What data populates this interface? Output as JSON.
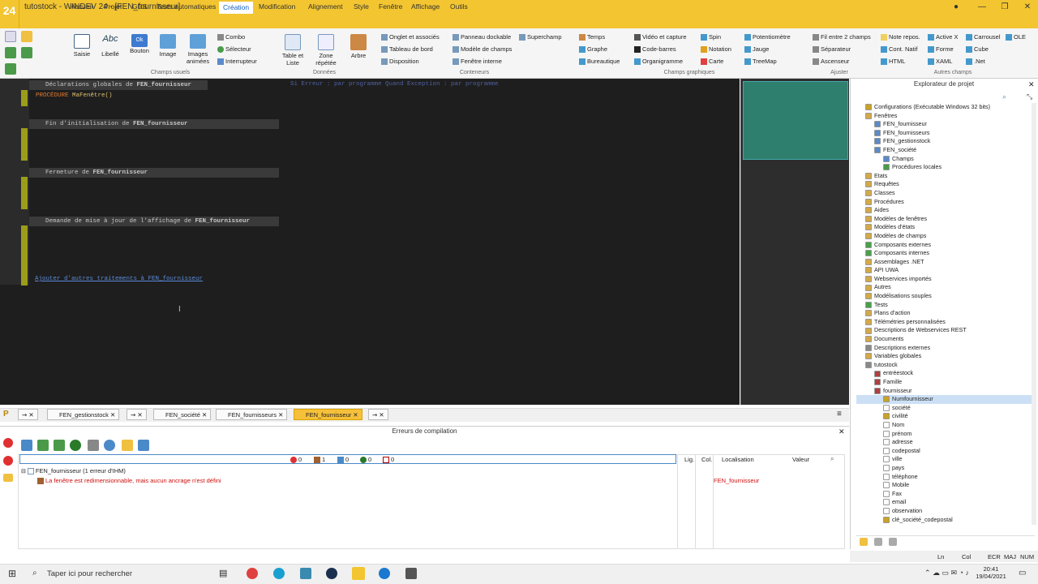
{
  "window": {
    "title": "tutostock - WINDEV 24 - [FEN_fournisseur]",
    "logo": "24"
  },
  "menu": [
    "Accueil",
    "Projet",
    "GDS",
    "Tests automatiques",
    "Création",
    "Modification",
    "Alignement",
    "Style",
    "Fenêtre",
    "Affichage",
    "Outils"
  ],
  "ribbon": {
    "big": [
      "Saisie",
      "Libellé",
      "Bouton",
      "Image",
      "Images animées"
    ],
    "champs_small": [
      "Combo",
      "Sélecteur",
      "Interrupteur"
    ],
    "donnees": [
      "Table et Liste",
      "Zone répétée",
      "Arbre"
    ],
    "conteneurs": [
      "Onglet et associés",
      "Tableau de bord",
      "Disposition",
      "Panneau dockable",
      "Modèle de champs",
      "Fenêtre interne",
      "Superchamp"
    ],
    "graph": [
      "Temps",
      "Graphe",
      "Bureautique",
      "Vidéo et capture",
      "Code-barres",
      "Organigramme",
      "Spin",
      "Notation",
      "Carte",
      "Potentiomètre",
      "Jauge",
      "TreeMap"
    ],
    "ajuster": [
      "Fil entre 2 champs",
      "Séparateur",
      "Ascenseur"
    ],
    "autres": [
      "Note repos.",
      "Active X",
      "Carrousel",
      "OLE",
      "Cont. Natif",
      "Forme",
      "Cube",
      "HTML",
      "XAML",
      ".Net"
    ],
    "groups": [
      "Champs usuels",
      "Données",
      "Conteneurs",
      "Champs graphiques",
      "Ajuster",
      "Autres champs"
    ]
  },
  "editor": {
    "s1": "Déclarations globales de ",
    "s1b": "FEN_fournisseur",
    "s1right": "Si Erreur : par programme  Quand Exception : par programme",
    "proc_kw": "PROCÉDURE",
    "proc_name": " MaFenêtre()",
    "s2": "Fin d'initialisation de ",
    "s2b": "FEN_fournisseur",
    "s3": "Fermeture de ",
    "s3b": "FEN_fournisseur",
    "s4": "Demande de mise à jour de l'affichage de ",
    "s4b": "FEN_fournisseur",
    "add_link": "Ajouter d'autres traitements à FEN_fournisseur"
  },
  "explorer": {
    "title": "Explorateur de projet",
    "items": [
      {
        "label": "Configurations (Exécutable Windows 32 bits)",
        "lvl": 1,
        "c": "#c9a227"
      },
      {
        "label": "Fenêtres",
        "lvl": 1,
        "c": "#d4a94a"
      },
      {
        "label": "FEN_fournisseur",
        "lvl": 2,
        "c": "#5a8ac9"
      },
      {
        "label": "FEN_fournisseurs",
        "lvl": 2,
        "c": "#5a8ac9"
      },
      {
        "label": "FEN_gestionstock",
        "lvl": 2,
        "c": "#5a8ac9"
      },
      {
        "label": "FEN_société",
        "lvl": 2,
        "c": "#5a8ac9"
      },
      {
        "label": "Champs",
        "lvl": 3,
        "c": "#5a8ac9"
      },
      {
        "label": "Procédures locales",
        "lvl": 3,
        "c": "#4a9a4a"
      },
      {
        "label": "Etats",
        "lvl": 1,
        "c": "#d4a94a"
      },
      {
        "label": "Requêtes",
        "lvl": 1,
        "c": "#d4a94a"
      },
      {
        "label": "Classes",
        "lvl": 1,
        "c": "#d4a94a"
      },
      {
        "label": "Procédures",
        "lvl": 1,
        "c": "#d4a94a"
      },
      {
        "label": "Aides",
        "lvl": 1,
        "c": "#d4a94a"
      },
      {
        "label": "Modèles de fenêtres",
        "lvl": 1,
        "c": "#d4a94a"
      },
      {
        "label": "Modèles d'états",
        "lvl": 1,
        "c": "#d4a94a"
      },
      {
        "label": "Modèles de champs",
        "lvl": 1,
        "c": "#d4a94a"
      },
      {
        "label": "Composants externes",
        "lvl": 1,
        "c": "#4aa04a"
      },
      {
        "label": "Composants internes",
        "lvl": 1,
        "c": "#4aa04a"
      },
      {
        "label": "Assemblages .NET",
        "lvl": 1,
        "c": "#d4a94a"
      },
      {
        "label": "API UWA",
        "lvl": 1,
        "c": "#d4a94a"
      },
      {
        "label": "Webservices importés",
        "lvl": 1,
        "c": "#d4a94a"
      },
      {
        "label": "Autres",
        "lvl": 1,
        "c": "#d4a94a"
      },
      {
        "label": "Modélisations souples",
        "lvl": 1,
        "c": "#d4a94a"
      },
      {
        "label": "Tests",
        "lvl": 1,
        "c": "#4aa04a"
      },
      {
        "label": "Plans d'action",
        "lvl": 1,
        "c": "#d4a94a"
      },
      {
        "label": "Télémétries personnalisées",
        "lvl": 1,
        "c": "#d4a94a"
      },
      {
        "label": "Descriptions de Webservices REST",
        "lvl": 1,
        "c": "#d4a94a"
      },
      {
        "label": "Documents",
        "lvl": 1,
        "c": "#d4a94a"
      },
      {
        "label": "Descriptions externes",
        "lvl": 1,
        "c": "#888"
      },
      {
        "label": "Variables globales",
        "lvl": 1,
        "c": "#d4a94a"
      },
      {
        "label": "tutostock",
        "lvl": 1,
        "c": "#888"
      },
      {
        "label": "entréestock",
        "lvl": 2,
        "c": "#b04040"
      },
      {
        "label": "Famille",
        "lvl": 2,
        "c": "#b04040"
      },
      {
        "label": "fournisseur",
        "lvl": 2,
        "c": "#b04040"
      },
      {
        "label": "Numfournisseur",
        "lvl": 3,
        "c": "#c9a227",
        "sel": true
      },
      {
        "label": "société",
        "lvl": 3,
        "c": "#ffffff"
      },
      {
        "label": "civilité",
        "lvl": 3,
        "c": "#c9a227"
      },
      {
        "label": "Nom",
        "lvl": 3,
        "c": "#ffffff"
      },
      {
        "label": "prénom",
        "lvl": 3,
        "c": "#ffffff"
      },
      {
        "label": "adresse",
        "lvl": 3,
        "c": "#ffffff"
      },
      {
        "label": "codepostal",
        "lvl": 3,
        "c": "#ffffff"
      },
      {
        "label": "ville",
        "lvl": 3,
        "c": "#ffffff"
      },
      {
        "label": "pays",
        "lvl": 3,
        "c": "#ffffff"
      },
      {
        "label": "téléphone",
        "lvl": 3,
        "c": "#ffffff"
      },
      {
        "label": "Mobile",
        "lvl": 3,
        "c": "#ffffff"
      },
      {
        "label": "Fax",
        "lvl": 3,
        "c": "#ffffff"
      },
      {
        "label": "email",
        "lvl": 3,
        "c": "#ffffff"
      },
      {
        "label": "observation",
        "lvl": 3,
        "c": "#ffffff"
      },
      {
        "label": "clé_société_codepostal",
        "lvl": 3,
        "c": "#c9a227"
      }
    ]
  },
  "tabs": [
    "FEN_gestionstock",
    "FEN_société",
    "FEN_fournisseurs",
    "FEN_fournisseur"
  ],
  "errors": {
    "title": "Erreurs de compilation",
    "counts": [
      "0",
      "1",
      "0",
      "0",
      "0"
    ],
    "cols": [
      "Lig.",
      "Col.",
      "Localisation",
      "Valeur"
    ],
    "group": "FEN_fournisseur (1 erreur d'IHM)",
    "message": "La fenêtre est redimensionnable, mais aucun ancrage n'est défini",
    "location": "FEN_fournisseur"
  },
  "status": [
    "Ln",
    "Col",
    "ECR",
    "MAJ",
    "NUM"
  ],
  "taskbar": {
    "search": "Taper ici pour rechercher",
    "time": "20:41",
    "date": "19/04/2021"
  },
  "colors": {
    "accent": "#f2c531",
    "editor_bg": "#1e1e1e",
    "link": "#5b8bd8",
    "error": "#d01010"
  }
}
